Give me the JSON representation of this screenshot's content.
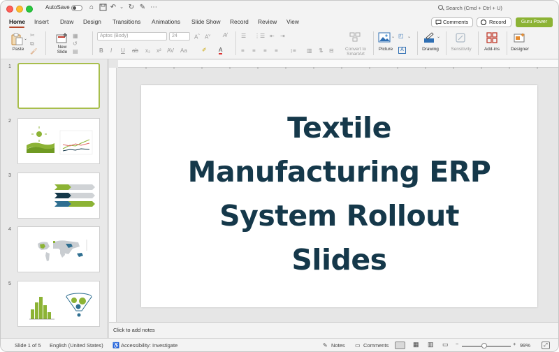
{
  "titlebar": {
    "autosave_label": "AutoSave",
    "search_placeholder": "Search (Cmd + Ctrl + U)"
  },
  "menu": {
    "tabs": [
      "Home",
      "Insert",
      "Draw",
      "Design",
      "Transitions",
      "Animations",
      "Slide Show",
      "Record",
      "Review",
      "View"
    ],
    "active_tab": "Home",
    "comments_label": "Comments",
    "record_label": "Record",
    "guru_label": "Guru Power"
  },
  "ribbon": {
    "paste_label": "Paste",
    "new_slide_label": "New\nSlide",
    "font_name": "Aptos (Body)",
    "font_size": "24",
    "convert_smartart_label": "Convert to\nSmartArt",
    "picture_label": "Picture",
    "drawing_label": "Drawing",
    "sensitivity_label": "Sensitivity",
    "addins_label": "Add-ins",
    "designer_label": "Designer"
  },
  "thumbnails": {
    "numbers": [
      "1",
      "2",
      "3",
      "4",
      "5"
    ],
    "selected": "1"
  },
  "slide": {
    "title_lines": [
      "Textile",
      "Manufacturing ERP",
      "System Rollout",
      "Slides"
    ]
  },
  "notes": {
    "placeholder": "Click to add notes"
  },
  "status": {
    "slide_count": "Slide 1 of 5",
    "language": "English (United States)",
    "accessibility": "Accessibility: Investigate",
    "notes_label": "Notes",
    "comments_label": "Comments",
    "zoom": "99%"
  },
  "colors": {
    "accent": "#b7472a",
    "guru": "#8cb335",
    "title": "#15384a",
    "thumb_selected": "#a8be4c"
  }
}
